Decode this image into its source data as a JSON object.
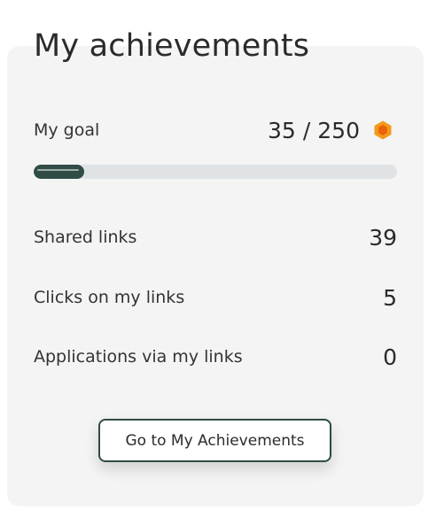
{
  "title": "My achievements",
  "goal": {
    "label": "My goal",
    "current": "35",
    "separator": "/",
    "target": "250",
    "progress_fraction": 0.14,
    "icon": "hexagon-coin-icon",
    "colors": {
      "fill": "#2f4c46",
      "track": "#dfe3e6",
      "coin_outer": "#f39a1b",
      "coin_inner": "#e8630a"
    }
  },
  "stats": [
    {
      "label": "Shared links",
      "value": "39"
    },
    {
      "label": "Clicks on my links",
      "value": "5"
    },
    {
      "label": "Applications via my links",
      "value": "0"
    }
  ],
  "cta": {
    "label": "Go to My Achievements"
  }
}
